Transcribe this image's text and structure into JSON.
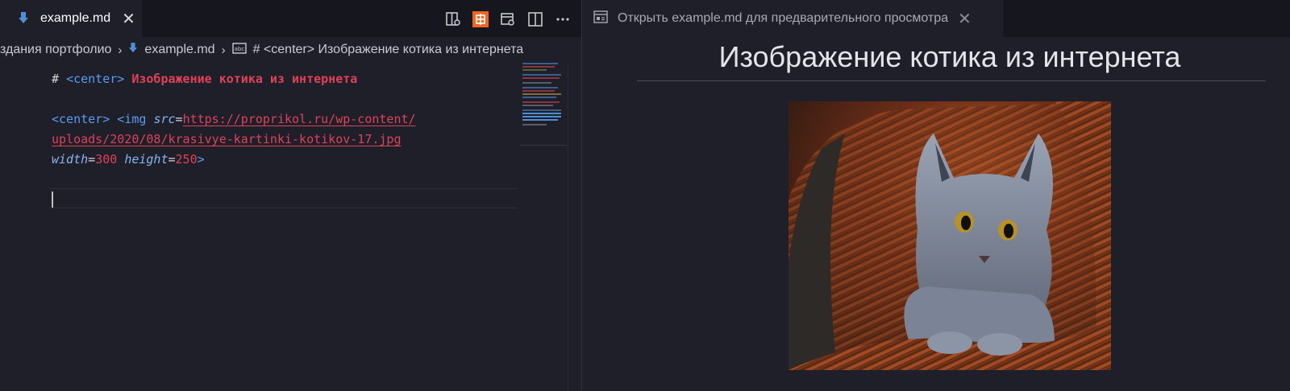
{
  "editor": {
    "tab": {
      "label": "example.md",
      "close": "✕"
    },
    "breadcrumb": {
      "folder": "здания портфолио",
      "file": "example.md",
      "symbol": "# <center> Изображение котика из интернета"
    },
    "code": {
      "line1": {
        "hash": "# ",
        "tag": "<center>",
        "heading": " Изображение котика из интернета"
      },
      "line3": {
        "tag_open": "<center> <img ",
        "attr_src": "src",
        "eq": "=",
        "url_part1": "https://proprikol.ru/wp-content/"
      },
      "line4": {
        "url_part2": "uploads/2020/08/krasivye-kartinki-kotikov-17.jpg"
      },
      "line5": {
        "attr_width": "width",
        "eq1": "=",
        "width_val": "300",
        "space": " ",
        "attr_height": "height",
        "eq2": "=",
        "height_val": "250",
        "close": ">"
      }
    },
    "actions": [
      "open-changes-icon",
      "extension-icon",
      "open-preview-side-icon",
      "split-editor-icon",
      "more-actions-icon"
    ]
  },
  "preview": {
    "tab": {
      "label": "Открыть example.md для предварительного просмотра",
      "close": "✕"
    },
    "heading": "Изображение котика из интернета",
    "image_alt": "kitten in a wicker basket"
  },
  "colors": {
    "background": "#1e1f29",
    "tabbar": "#16171e",
    "tag": "#5b9bf0",
    "heading": "#e0415b",
    "markdown_icon": "#4f8fd6",
    "extension_icon": "#f26522"
  }
}
